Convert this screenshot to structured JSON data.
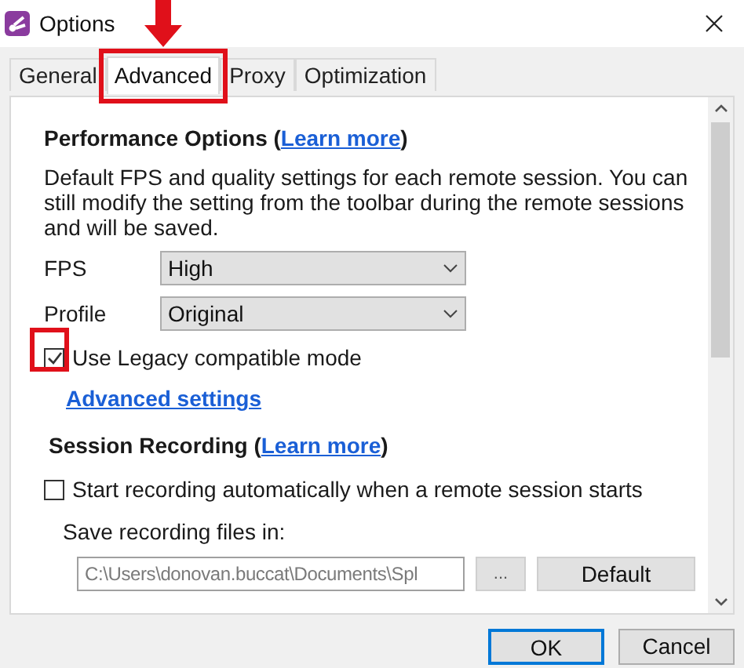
{
  "window": {
    "title": "Options"
  },
  "tabs": [
    {
      "label": "General",
      "selected": false,
      "highlighted": false
    },
    {
      "label": "Advanced",
      "selected": true,
      "highlighted": true
    },
    {
      "label": "Proxy",
      "selected": false,
      "highlighted": false
    },
    {
      "label": "Optimization",
      "selected": false,
      "highlighted": false
    }
  ],
  "performance": {
    "heading": "Performance Options (",
    "link": "Learn more",
    "heading_end": ")",
    "description": "Default FPS and quality settings for each remote session. You can still modify the setting from the toolbar during the remote sessions and will be saved.",
    "selects": [
      {
        "label": "FPS",
        "value": "High"
      },
      {
        "label": "Profile",
        "value": "Original"
      }
    ],
    "legacy": {
      "label": "Use Legacy compatible mode",
      "checked": true,
      "highlighted": true
    },
    "advanced_link": "Advanced settings"
  },
  "recording": {
    "heading": "Session Recording (",
    "link": "Learn more",
    "heading_end": ")",
    "auto": {
      "label": "Start recording automatically when a remote session starts",
      "checked": false
    },
    "save_label": "Save recording files in:",
    "path": "C:\\Users\\donovan.buccat\\Documents\\Spl",
    "browse": "...",
    "default": "Default"
  },
  "buttons": [
    {
      "label": "OK",
      "default": true
    },
    {
      "label": "Cancel",
      "default": false
    }
  ]
}
